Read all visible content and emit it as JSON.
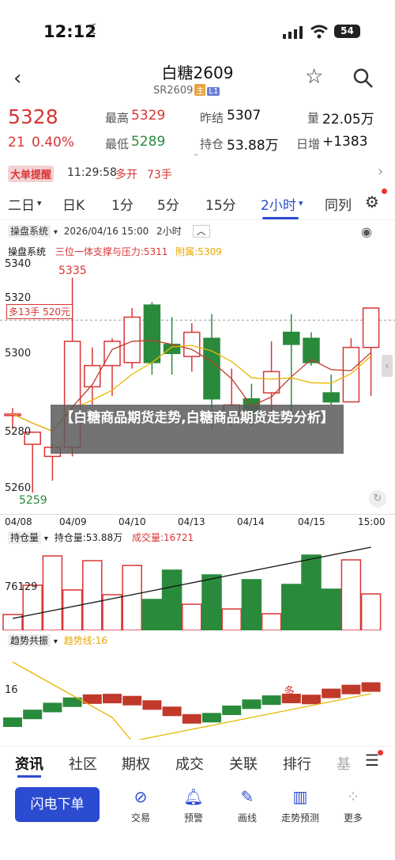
{
  "status": {
    "time": "12:12",
    "battery": "54"
  },
  "header": {
    "title": "白糖2609",
    "code": "SR2609",
    "tag_main": "主",
    "tag_l1": "L1"
  },
  "quote": {
    "price": "5328",
    "change": "21",
    "pct": "0.40%",
    "high_label": "最高",
    "high": "5329",
    "low_label": "最低",
    "low": "5289",
    "prev_label": "昨结",
    "prev": "5307",
    "oi_label": "持仓",
    "oi": "53.88万",
    "vol_label": "量",
    "vol": "22.05万",
    "daily_label": "日增",
    "daily": "+1383"
  },
  "alert": {
    "tag": "大单提醒",
    "time": "11:29:58",
    "type": "多开",
    "qty": "73手"
  },
  "tabs": [
    "二日",
    "日K",
    "1分",
    "5分",
    "15分",
    "2小时",
    "同列"
  ],
  "active_tab": "2小时",
  "main_chart": {
    "system": "操盘系统",
    "date": "2026/04/16 15:00",
    "period": "2小时",
    "legend_name": "操盘系统",
    "legend_sr": "三位一体支撑与压力:5311",
    "legend_attach": "附属:5309",
    "y_labels": [
      "5340",
      "5320",
      "5300",
      "5280",
      "5260"
    ],
    "high_mark": "5335",
    "low_mark": "5259",
    "pos_label": "多13手 520元",
    "x_labels": [
      "04/08",
      "04/09",
      "04/10",
      "04/13",
      "04/14",
      "04/15",
      "15:00"
    ]
  },
  "oi_chart": {
    "selector": "持仓量",
    "oi": "持仓量:53.88万",
    "vol": "成交量:16721",
    "y_label": "76129"
  },
  "trend_chart": {
    "selector": "趋势共振",
    "line": "趋势线:16",
    "y_label": "16",
    "mark": "多"
  },
  "watermark": "【白糖商品期货走势,白糖商品期货走势分析】",
  "bottom_tabs": [
    "资讯",
    "社区",
    "期权",
    "成交",
    "关联",
    "排行",
    "基"
  ],
  "actions": {
    "flash": "闪电下单",
    "tools": [
      "交易",
      "预警",
      "画线",
      "走势预测",
      "更多"
    ]
  },
  "chart_data": {
    "type": "candlestick",
    "series": [
      {
        "name": "candles",
        "values": [
          {
            "o": 5290,
            "h": 5292,
            "l": 5285,
            "c": 5290
          },
          {
            "o": 5280,
            "h": 5284,
            "l": 5264,
            "c": 5284
          },
          {
            "o": 5276,
            "h": 5280,
            "l": 5268,
            "c": 5279
          },
          {
            "o": 5279,
            "h": 5335,
            "l": 5276,
            "c": 5314
          },
          {
            "o": 5299,
            "h": 5312,
            "l": 5293,
            "c": 5306
          },
          {
            "o": 5306,
            "h": 5315,
            "l": 5296,
            "c": 5314
          },
          {
            "o": 5307,
            "h": 5325,
            "l": 5305,
            "c": 5322
          },
          {
            "o": 5326,
            "h": 5327,
            "l": 5303,
            "c": 5307
          },
          {
            "o": 5313,
            "h": 5322,
            "l": 5303,
            "c": 5310
          },
          {
            "o": 5309,
            "h": 5320,
            "l": 5304,
            "c": 5317
          },
          {
            "o": 5315,
            "h": 5323,
            "l": 5285,
            "c": 5295
          },
          {
            "o": 5288,
            "h": 5305,
            "l": 5286,
            "c": 5293
          },
          {
            "o": 5295,
            "h": 5300,
            "l": 5286,
            "c": 5290
          },
          {
            "o": 5297,
            "h": 5314,
            "l": 5290,
            "c": 5304
          },
          {
            "o": 5317,
            "h": 5323,
            "l": 5288,
            "c": 5313
          },
          {
            "o": 5315,
            "h": 5317,
            "l": 5306,
            "c": 5307
          },
          {
            "o": 5297,
            "h": 5303,
            "l": 5293,
            "c": 5294
          },
          {
            "o": 5294,
            "h": 5315,
            "l": 5296,
            "c": 5312
          },
          {
            "o": 5312,
            "h": 5324,
            "l": 5296,
            "c": 5325
          }
        ]
      }
    ],
    "ylim": [
      5257,
      5342
    ]
  }
}
